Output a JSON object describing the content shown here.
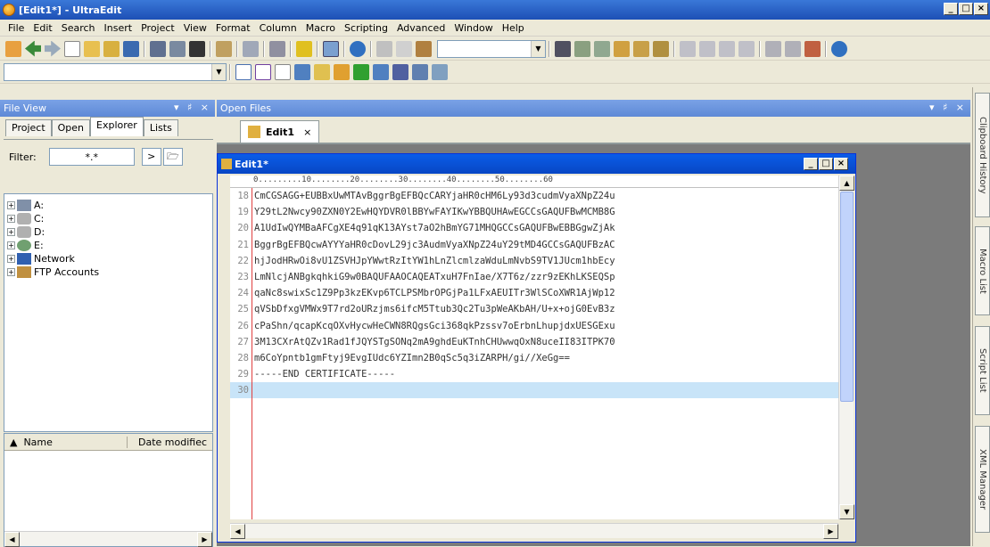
{
  "window": {
    "title": "[Edit1*] - UltraEdit"
  },
  "menu": [
    "File",
    "Edit",
    "Search",
    "Insert",
    "Project",
    "View",
    "Format",
    "Column",
    "Macro",
    "Scripting",
    "Advanced",
    "Window",
    "Help"
  ],
  "file_view": {
    "title": "File View",
    "tabs": [
      "Project",
      "Open",
      "Explorer",
      "Lists"
    ],
    "active_tab": "Explorer",
    "filter_label": "Filter:",
    "filter_value": "*.*",
    "tree": [
      {
        "label": "A:",
        "icon": "floppy-drive-icon"
      },
      {
        "label": "C:",
        "icon": "hard-drive-icon"
      },
      {
        "label": "D:",
        "icon": "hard-drive-icon"
      },
      {
        "label": "E:",
        "icon": "cd-drive-icon"
      },
      {
        "label": "Network",
        "icon": "network-icon"
      },
      {
        "label": "FTP Accounts",
        "icon": "ftp-icon"
      }
    ],
    "list_columns": [
      "Name",
      "Date modifiec"
    ]
  },
  "open_files": {
    "title": "Open Files",
    "tab_label": "Edit1"
  },
  "editor": {
    "window_title": "Edit1*",
    "ruler": "0.........10........20........30........40........50........60",
    "lines": [
      {
        "n": "18",
        "text": "CmCGSAGG+EUBBxUwMTAvBggrBgEFBQcCARYjaHR0cHM6Ly93d3cudmVyaXNpZ24u"
      },
      {
        "n": "19",
        "text": "Y29tL2Nwcy90ZXN0Y2EwHQYDVR0lBBYwFAYIKwYBBQUHAwEGCCsGAQUFBwMCMB8G"
      },
      {
        "n": "20",
        "text": "A1UdIwQYMBaAFCgXE4q91qK13AYst7aO2hBmYG71MHQGCCsGAQUFBwEBBGgwZjAk"
      },
      {
        "n": "21",
        "text": "BggrBgEFBQcwAYYYaHR0cDovL29jc3AudmVyaXNpZ24uY29tMD4GCCsGAQUFBzAC"
      },
      {
        "n": "22",
        "text": "hjJodHRwOi8vU1ZSVHJpYWwtRzItYW1hLnZlcmlzaWduLmNvbS9TV1JUcm1hbEcy"
      },
      {
        "n": "23",
        "text": "LmNlcjANBgkqhkiG9w0BAQUFAAOCAQEATxuH7FnIae/X7T6z/zzr9zEKhLKSEQSp"
      },
      {
        "n": "24",
        "text": "qaNc8swixSc1Z9Pp3kzEKvp6TCLPSMbrOPGjPa1LFxAEUITr3WlSCoXWR1AjWp12"
      },
      {
        "n": "25",
        "text": "qVSbDfxgVMWx9T7rd2oURzjms6ifcM5Ttub3Qc2Tu3pWeAKbAH/U+x+ojG0EvB3z"
      },
      {
        "n": "26",
        "text": "cPaShn/qcapKcqOXvHycwHeCWN8RQgsGci368qkPzssv7oErbnLhupjdxUESGExu"
      },
      {
        "n": "27",
        "text": "3M13CXrAtQZv1Rad1fJQYSTgSONq2mA9ghdEuKTnhCHUwwqOxN8uceII83ITPK70"
      },
      {
        "n": "28",
        "text": "m6CoYpntb1gmFtyj9EvgIUdc6YZImn2B0qSc5q3iZARPH/gi//XeGg=="
      },
      {
        "n": "29",
        "text": "-----END CERTIFICATE-----"
      },
      {
        "n": "30",
        "text": ""
      }
    ],
    "current_line": "30"
  },
  "right_dock": [
    "Clipboard History",
    "Macro List",
    "Script List",
    "XML Manager"
  ]
}
